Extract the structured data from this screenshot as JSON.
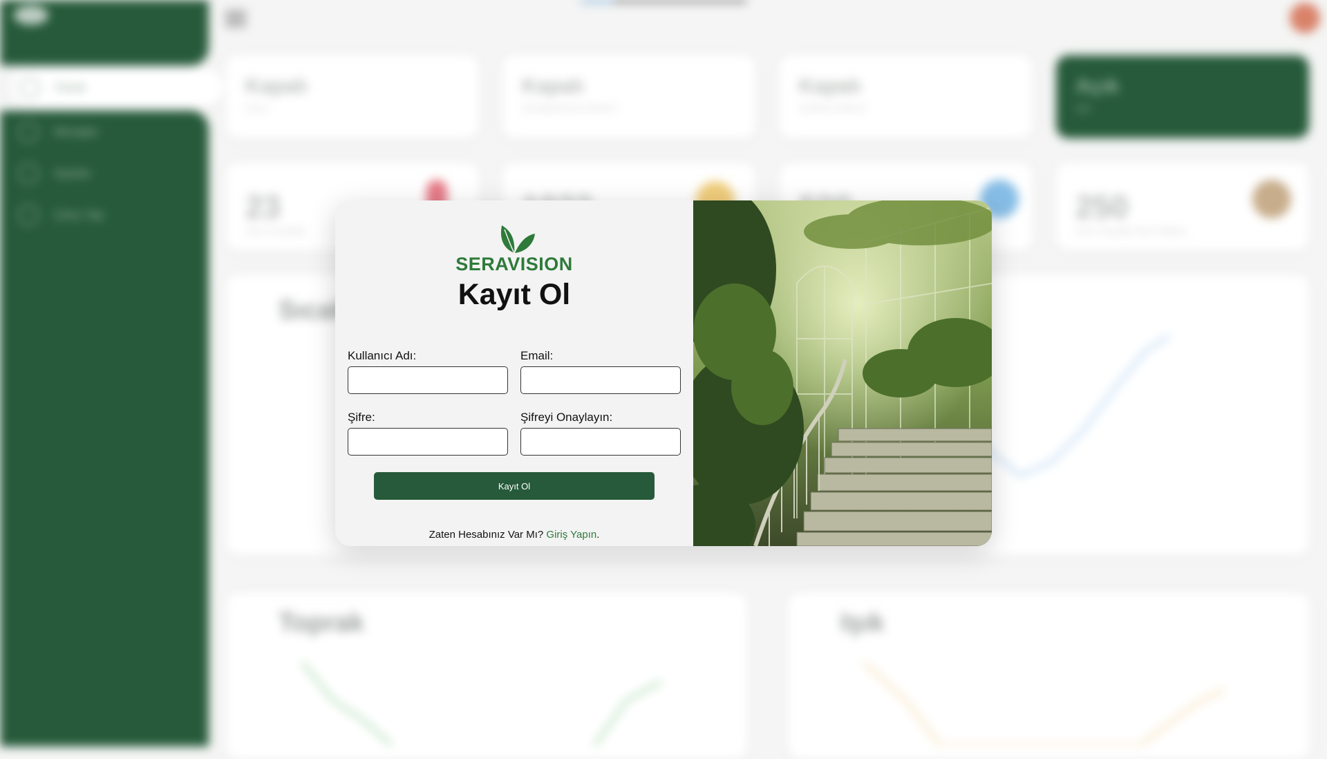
{
  "background": {
    "sidebar": {
      "items": [
        "Panel",
        "Mesajlar",
        "Ayarlar",
        "Çıkış Yap"
      ]
    },
    "status_cards": [
      {
        "state": "Kapalı",
        "label": "Isıtıcı"
      },
      {
        "state": "Kapalı",
        "label": "Havalandırma Sistemi"
      },
      {
        "state": "Kapalı",
        "label": "Sulama Sistemi"
      },
      {
        "state": "Açık",
        "label": "Işık"
      }
    ],
    "metric_cards": [
      {
        "value": "23",
        "label": "Sera Sıcaklığı"
      },
      {
        "value": "1022",
        "label": ""
      },
      {
        "value": "500",
        "label": ""
      },
      {
        "value": "250",
        "label": "Sera Toprağı Nemi Miktarı"
      }
    ],
    "panels": [
      "Sıcak",
      "Toprak",
      "Işık"
    ]
  },
  "modal": {
    "brand_name": "SERAVISION",
    "title": "Kayıt Ol",
    "fields": {
      "username_label": "Kullanıcı Adı:",
      "email_label": "Email:",
      "password_label": "Şifre:",
      "confirm_label": "Şifreyi Onaylayın:"
    },
    "submit_label": "Kayıt Ol",
    "login_prompt": "Zaten Hesabınız Var Mı?",
    "login_link": "Giriş Yapın",
    "login_suffix": ".",
    "colors": {
      "accent": "#265a3a",
      "brand": "#2e7a3a"
    }
  }
}
